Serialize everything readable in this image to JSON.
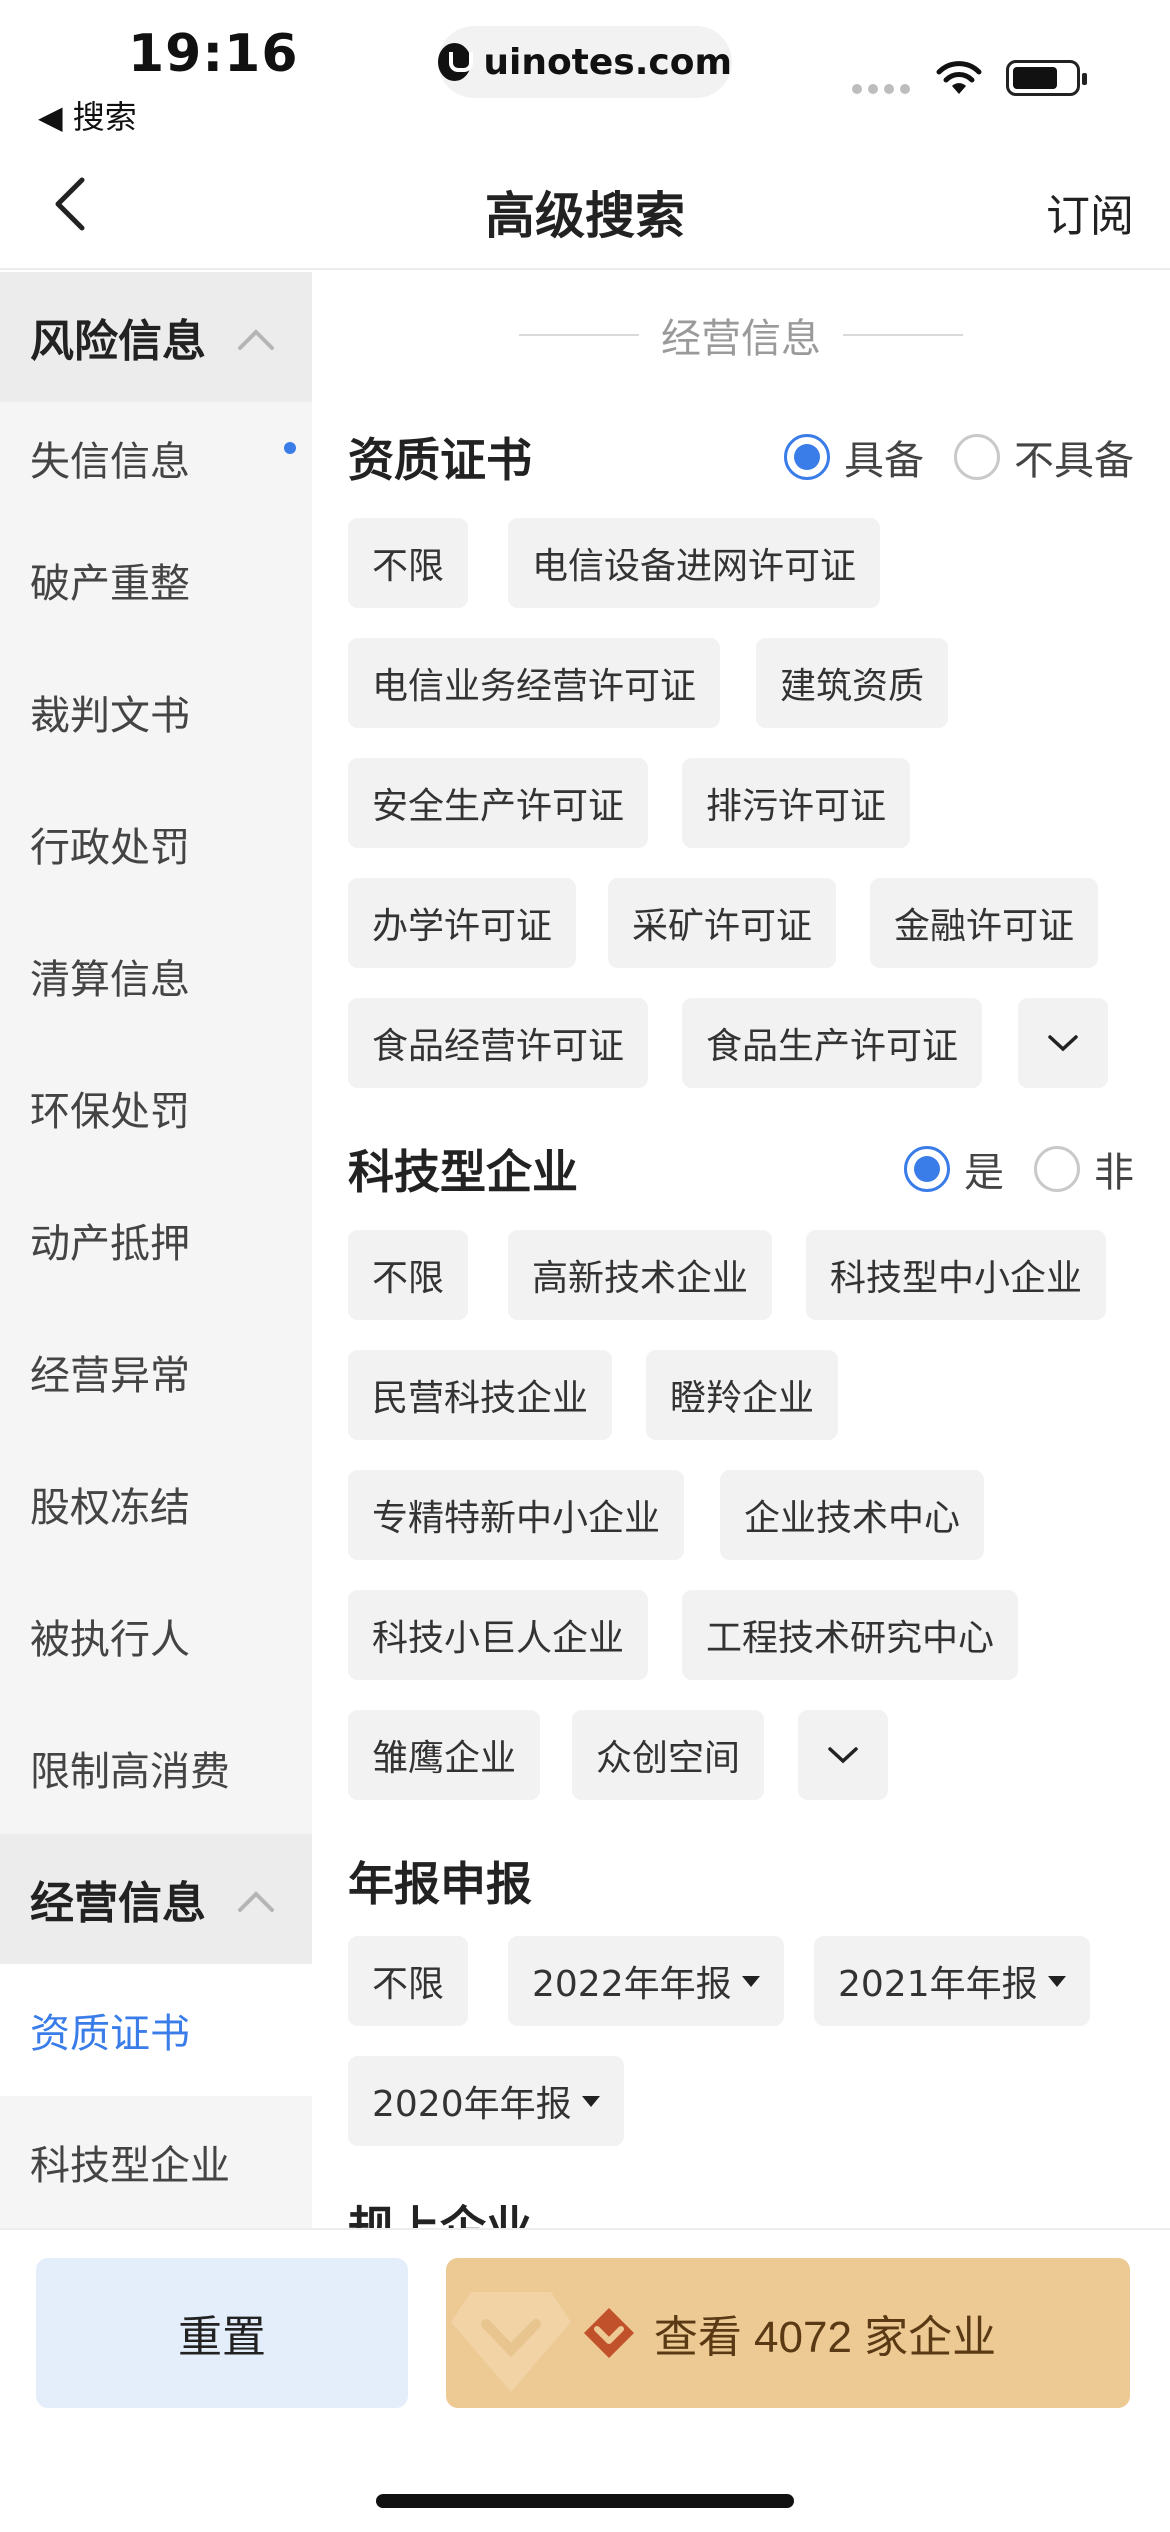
{
  "status_bar": {
    "time": "19:16",
    "back_label": "◀ 搜索",
    "url": "uinotes.com"
  },
  "nav": {
    "title": "高级搜索",
    "subscribe": "订阅"
  },
  "sidebar": {
    "group_risk": "风险信息",
    "risk_items": [
      "失信信息",
      "破产重整",
      "裁判文书",
      "行政处罚",
      "清算信息",
      "环保处罚",
      "动产抵押",
      "经营异常",
      "股权冻结",
      "被执行人",
      "限制高消费"
    ],
    "group_business": "经营信息",
    "business_items": [
      "资质证书",
      "科技型企业"
    ],
    "active_item": "资质证书"
  },
  "main": {
    "section_title": "经营信息",
    "qualification": {
      "title": "资质证书",
      "radio_have": "具备",
      "radio_not_have": "不具备",
      "selected": "具备",
      "tags": [
        "不限",
        "电信设备进网许可证",
        "电信业务经营许可证",
        "建筑资质",
        "安全生产许可证",
        "排污许可证",
        "办学许可证",
        "采矿许可证",
        "金融许可证",
        "食品经营许可证",
        "食品生产许可证"
      ]
    },
    "tech_enterprise": {
      "title": "科技型企业",
      "radio_yes": "是",
      "radio_no": "非",
      "selected": "是",
      "tags": [
        "不限",
        "高新技术企业",
        "科技型中小企业",
        "民营科技企业",
        "瞪羚企业",
        "专精特新中小企业",
        "企业技术中心",
        "科技小巨人企业",
        "工程技术研究中心",
        "雏鹰企业",
        "众创空间"
      ]
    },
    "annual_report": {
      "title": "年报申报",
      "tags": [
        "不限",
        "2022年年报",
        "2021年年报",
        "2020年年报"
      ]
    },
    "next_title": "规上企业"
  },
  "bottom": {
    "reset": "重置",
    "view": "查看 4072 家企业"
  },
  "colors": {
    "accent": "#3a7de8",
    "primary_button": "#edc994",
    "reset_button": "#e3eefa"
  }
}
